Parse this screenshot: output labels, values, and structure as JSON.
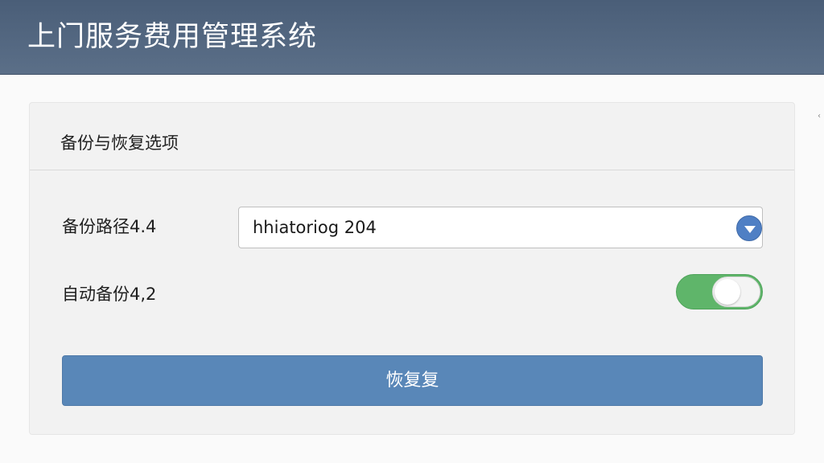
{
  "header": {
    "app_title": "上门服务费用管理系统"
  },
  "panel": {
    "title": "备份与恢复选项",
    "backup_path": {
      "label": "备份路径4.4",
      "selected_value": "hhiatoriog 204"
    },
    "auto_backup": {
      "label": "自动备份4,2",
      "enabled": true
    },
    "restore_button_label": "恢复复"
  },
  "colors": {
    "header_bg": "#4f637d",
    "toggle_on": "#5fb56a",
    "button_primary": "#5987b8",
    "select_caret": "#4f7fc4"
  },
  "icons": {
    "select_caret": "chevron-down-icon"
  }
}
